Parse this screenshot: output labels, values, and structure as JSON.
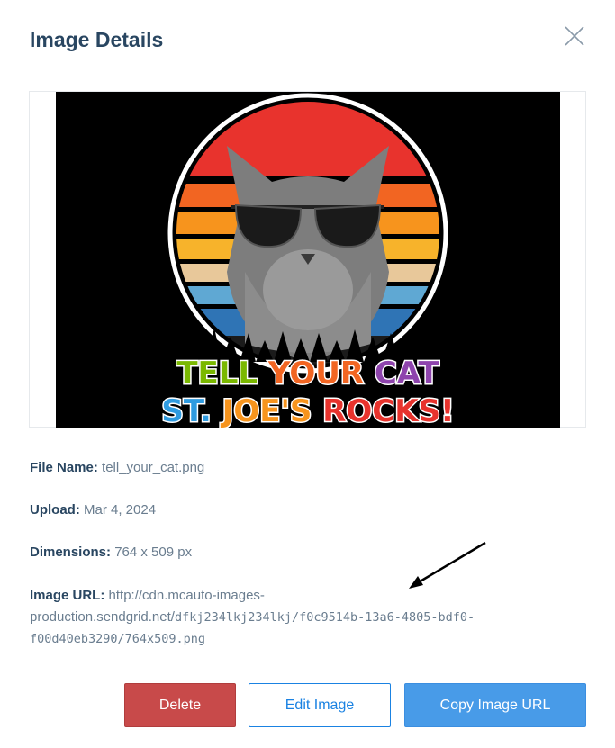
{
  "modal": {
    "title": "Image Details",
    "close_icon": "close-icon"
  },
  "image": {
    "alt": "tell_your_cat.png preview",
    "line1": "TELL YOUR CAT",
    "line2": "ST. JOE'S ROCKS!"
  },
  "details": {
    "file_name_label": "File Name:",
    "file_name_value": "tell_your_cat.png",
    "upload_label": "Upload:",
    "upload_value": "Mar 4, 2024",
    "dimensions_label": "Dimensions:",
    "dimensions_value": "764 x 509 px",
    "url_label": "Image URL:",
    "url_part1": "http://cdn.mcauto-images-production.sendgrid.net/",
    "url_part2": "dfkj234lkj234lkj/f0c9514b-13a6-4805-bdf0-",
    "url_part3": "f00d40eb3290/764x509.png"
  },
  "buttons": {
    "delete": "Delete",
    "edit": "Edit Image",
    "copy": "Copy Image URL"
  },
  "colors": {
    "title": "#294661",
    "delete": "#c84a4a",
    "edit_border": "#1a82e2",
    "copy": "#489be8"
  }
}
